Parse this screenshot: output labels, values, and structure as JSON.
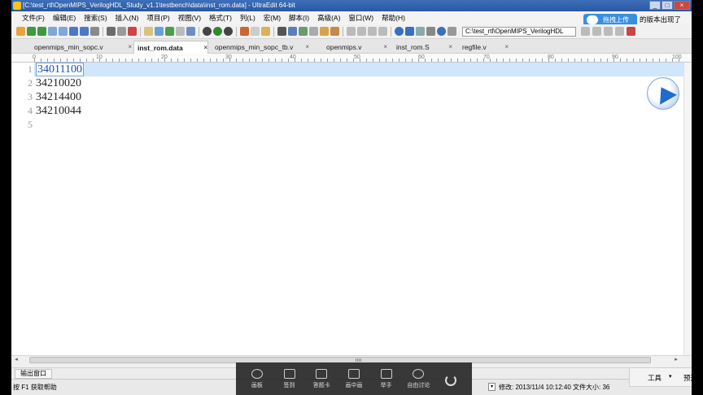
{
  "window": {
    "title": "[C:\\test_rtl\\OpenMIPS_VerilogHDL_Study_v1.1\\testbench\\data\\inst_rom.data] - UltraEdit 64-bit",
    "min": "_",
    "max": "□",
    "close": "×"
  },
  "menu": [
    "文件(F)",
    "编辑(E)",
    "搜索(S)",
    "插入(N)",
    "项目(P)",
    "视图(V)",
    "格式(T)",
    "列(L)",
    "宏(M)",
    "脚本(I)",
    "高级(A)",
    "窗口(W)",
    "帮助(H)"
  ],
  "upload": {
    "label": "拖拽上传"
  },
  "notice": "的版本出现了",
  "toolbar": {
    "path": "C:\\test_rtl\\OpenMIPS_VerilogHDL"
  },
  "tabs": [
    {
      "label": "openmips_min_sopc.v",
      "active": false
    },
    {
      "label": "inst_rom.data",
      "active": true
    },
    {
      "label": "openmips_min_sopc_tb.v",
      "active": false
    },
    {
      "label": "openmips.v",
      "active": false
    },
    {
      "label": "inst_rom.S",
      "active": false
    },
    {
      "label": "regfile.v",
      "active": false
    }
  ],
  "tab_close": "×",
  "ruler": [
    "0",
    "10",
    "20",
    "30",
    "40",
    "50",
    "60",
    "70",
    "80",
    "90",
    "100"
  ],
  "editor": {
    "lines": [
      {
        "num": "1",
        "text": "34011100"
      },
      {
        "num": "2",
        "text": "34210020"
      },
      {
        "num": "3",
        "text": "34214400"
      },
      {
        "num": "4",
        "text": "34210044"
      },
      {
        "num": "5",
        "text": ""
      }
    ]
  },
  "scrollbar": {
    "left": "◂",
    "right": "▸"
  },
  "output": {
    "tab_label": "输出窗口"
  },
  "status": {
    "help": "按 F1 获取帮助",
    "dropdown": "▾",
    "modified": "修改:  2013/11/4 10:12:40    文件大小:  36"
  },
  "overlay": {
    "items": [
      {
        "label": "画板",
        "icon": "palette-icon"
      },
      {
        "label": "签到",
        "icon": "calendar-check-icon"
      },
      {
        "label": "答题卡",
        "icon": "answer-card-icon"
      },
      {
        "label": "画中画",
        "icon": "picture-in-picture-icon"
      },
      {
        "label": "举手",
        "icon": "raise-hand-icon"
      },
      {
        "label": "自由讨论",
        "icon": "discussion-icon"
      },
      {
        "label": "",
        "icon": "power-icon"
      }
    ]
  },
  "right_widget": {
    "tools": "工具",
    "caret": "▾",
    "preview": "预选"
  }
}
